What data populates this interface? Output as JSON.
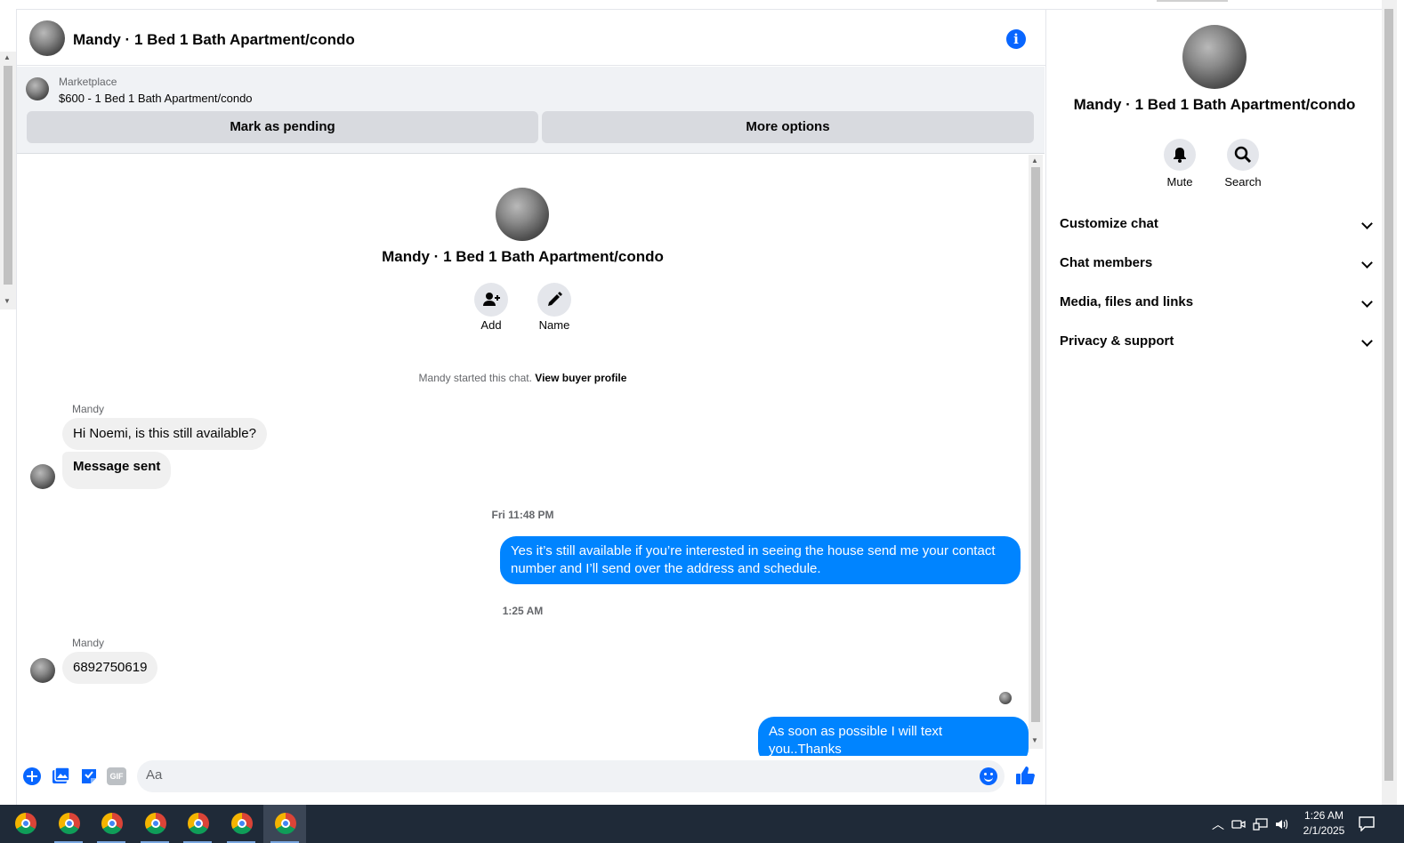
{
  "header": {
    "title": "Mandy · 1 Bed 1 Bath Apartment/condo",
    "info_icon": "info-icon"
  },
  "marketplace": {
    "label": "Marketplace",
    "listing": "$600 - 1 Bed 1 Bath Apartment/condo",
    "pending_button": "Mark as pending",
    "more_button": "More options"
  },
  "intro": {
    "name": "Mandy · 1 Bed 1 Bath Apartment/condo",
    "add_label": "Add",
    "name_label": "Name",
    "started_text": "Mandy started this chat.",
    "profile_link": "View buyer profile"
  },
  "messages": {
    "sender1": "Mandy",
    "msg1": "Hi Noemi, is this still available?",
    "msg2": "Message sent",
    "time1": "Fri 11:48 PM",
    "reply1_line1": "Yes it’s still available if you’re interested in seeing the house send me your contact",
    "reply1_line2": "number and I’ll send over the address and schedule.",
    "time2": "1:25 AM",
    "sender2": "Mandy",
    "msg3": "6892750619",
    "reply2": "As soon as possible I will text you..Thanks"
  },
  "composer": {
    "placeholder": "Aa",
    "gif_label": "GIF"
  },
  "right_panel": {
    "name": "Mandy · 1 Bed 1 Bath Apartment/condo",
    "mute_label": "Mute",
    "search_label": "Search",
    "sections": [
      "Customize chat",
      "Chat members",
      "Media, files and links",
      "Privacy & support"
    ]
  },
  "taskbar": {
    "time": "1:26 AM",
    "date": "2/1/2025"
  },
  "colors": {
    "accent": "#0866ff",
    "outgoing_bubble": "#0084ff",
    "incoming_bubble": "#f0f0f0",
    "taskbar": "#1f2a38"
  }
}
